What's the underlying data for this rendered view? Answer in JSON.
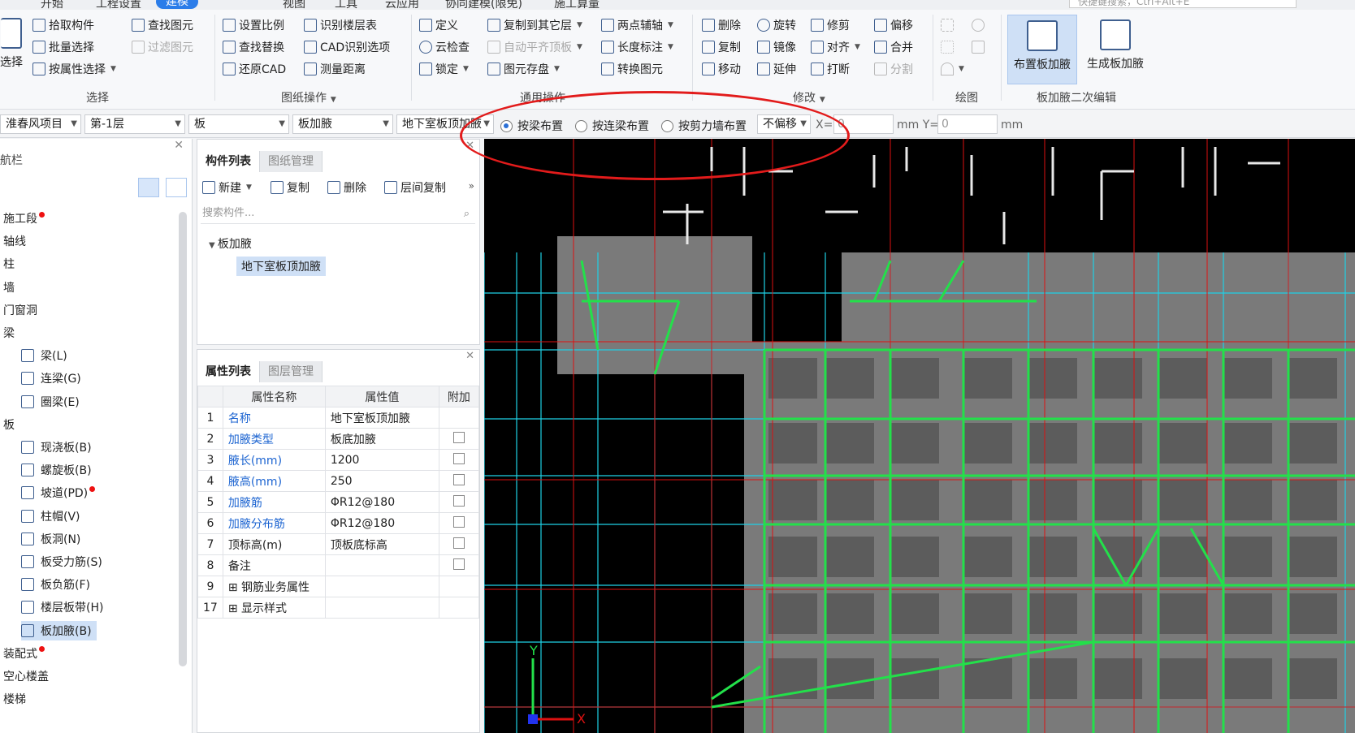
{
  "menubar": {
    "items": [
      "开始",
      "工程设置",
      "建模",
      "视图",
      "工具",
      "云应用",
      "协同建模(限免)",
      "施工算量"
    ],
    "active_index": 2,
    "search_placeholder": "快捷键搜索，Ctrl+Alt+E"
  },
  "ribbon": {
    "select_group": {
      "big_label": "选择",
      "buttons": [
        "拾取构件",
        "批量选择",
        "按属性选择",
        "查找图元",
        "过滤图元"
      ],
      "label": "选择"
    },
    "drawing_ops": {
      "buttons": [
        "设置比例",
        "查找替换",
        "还原CAD",
        "识别楼层表",
        "CAD识别选项",
        "测量距离"
      ],
      "label": "图纸操作"
    },
    "common_ops": {
      "buttons": [
        "定义",
        "云检查",
        "锁定",
        "复制到其它层",
        "自动平齐顶板",
        "图元存盘",
        "两点辅轴",
        "长度标注",
        "转换图元"
      ],
      "label": "通用操作"
    },
    "modify": {
      "buttons": [
        "删除",
        "复制",
        "移动",
        "旋转",
        "镜像",
        "延伸",
        "修剪",
        "对齐",
        "打断",
        "偏移",
        "合并",
        "分割"
      ],
      "label": "修改"
    },
    "draw": {
      "label": "绘图"
    },
    "secondary_edit": {
      "buttons": [
        "布置板加腋",
        "生成板加腋"
      ],
      "label": "板加腋二次编辑"
    }
  },
  "toolbar": {
    "project": "淮春风项目",
    "floor": "第-1层",
    "category": "板",
    "type": "板加腋",
    "component": "地下室板顶加腋",
    "radios": [
      "按梁布置",
      "按连梁布置",
      "按剪力墙布置"
    ],
    "radio_selected": 0,
    "offset": "不偏移",
    "x_label": "X=",
    "x_value": "0",
    "y_label": "mm Y=",
    "y_value": "0",
    "unit": "mm"
  },
  "nav": {
    "title": "航栏",
    "items": [
      {
        "label": "施工段",
        "dot": true
      },
      {
        "label": "轴线"
      },
      {
        "label": "柱"
      },
      {
        "label": "墙"
      },
      {
        "label": "门窗洞"
      },
      {
        "label": "梁"
      },
      {
        "label": "梁(L)",
        "child": true
      },
      {
        "label": "连梁(G)",
        "child": true
      },
      {
        "label": "圈梁(E)",
        "child": true
      },
      {
        "label": "板"
      },
      {
        "label": "现浇板(B)",
        "child": true
      },
      {
        "label": "螺旋板(B)",
        "child": true
      },
      {
        "label": "坡道(PD)",
        "child": true,
        "dot": true
      },
      {
        "label": "柱帽(V)",
        "child": true
      },
      {
        "label": "板洞(N)",
        "child": true
      },
      {
        "label": "板受力筋(S)",
        "child": true
      },
      {
        "label": "板负筋(F)",
        "child": true
      },
      {
        "label": "楼层板带(H)",
        "child": true
      },
      {
        "label": "板加腋(B)",
        "child": true,
        "selected": true
      },
      {
        "label": "装配式",
        "dot": true
      },
      {
        "label": "空心楼盖"
      },
      {
        "label": "楼梯"
      }
    ]
  },
  "component_panel": {
    "tabs": [
      "构件列表",
      "图纸管理"
    ],
    "actions": [
      "新建",
      "复制",
      "删除",
      "层间复制"
    ],
    "search_placeholder": "搜索构件...",
    "tree_root": "板加腋",
    "tree_child": "地下室板顶加腋"
  },
  "property_panel": {
    "tabs": [
      "属性列表",
      "图层管理"
    ],
    "headers": [
      "属性名称",
      "属性值",
      "附加"
    ],
    "rows": [
      {
        "num": "1",
        "name": "名称",
        "value": "地下室板顶加腋",
        "blue": true,
        "check": false
      },
      {
        "num": "2",
        "name": "加腋类型",
        "value": "板底加腋",
        "blue": true,
        "check": true
      },
      {
        "num": "3",
        "name": "腋长(mm)",
        "value": "1200",
        "blue": true,
        "check": true
      },
      {
        "num": "4",
        "name": "腋高(mm)",
        "value": "250",
        "blue": true,
        "check": true
      },
      {
        "num": "5",
        "name": "加腋筋",
        "value": "ΦR12@180",
        "blue": true,
        "check": true
      },
      {
        "num": "6",
        "name": "加腋分布筋",
        "value": "ΦR12@180",
        "blue": true,
        "check": true
      },
      {
        "num": "7",
        "name": "顶标高(m)",
        "value": "顶板底标高",
        "blue": false,
        "check": true
      },
      {
        "num": "8",
        "name": "备注",
        "value": "",
        "blue": false,
        "check": true
      },
      {
        "num": "9",
        "name": "钢筋业务属性",
        "value": "",
        "blue": false,
        "check": false,
        "expand": true
      },
      {
        "num": "17",
        "name": "显示样式",
        "value": "",
        "blue": false,
        "check": false,
        "expand": true
      }
    ]
  },
  "canvas": {
    "axis_x": "X",
    "axis_y": "Y"
  }
}
